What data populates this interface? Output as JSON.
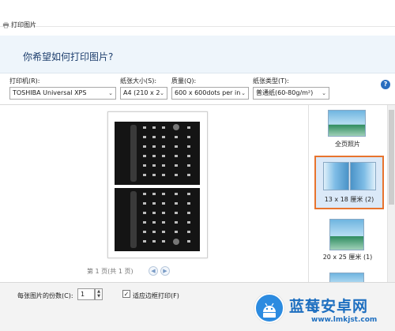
{
  "window": {
    "title": "打印图片"
  },
  "header": {
    "question": "你希望如何打印图片?"
  },
  "settings": {
    "printer_label": "打印机(R):",
    "printer_value": "TOSHIBA Universal XPS",
    "paper_size_label": "纸张大小(S):",
    "paper_size_value": "A4 (210 x 2",
    "quality_label": "质量(Q):",
    "quality_value": "600 x 600dots per in",
    "paper_type_label": "纸张类型(T):",
    "paper_type_value": "普通纸(60-80g/m²)",
    "help_icon": "?"
  },
  "preview": {
    "page_indicator": "第 1 页(共 1 页)"
  },
  "layouts": {
    "items": [
      {
        "label": "全页照片"
      },
      {
        "label": "13 x 18 厘米 (2)"
      },
      {
        "label": "20 x 25 厘米 (1)"
      }
    ],
    "selected": "13 x 18 厘米 (2)",
    "accent_color": "#e8742e"
  },
  "bottom": {
    "copies_label": "每张图片的份数(C):",
    "copies_value": "1",
    "fit_label": "适应边框打印(F)"
  },
  "watermark": {
    "title": "蓝莓安卓网",
    "url": "www.lmkjst.com"
  }
}
